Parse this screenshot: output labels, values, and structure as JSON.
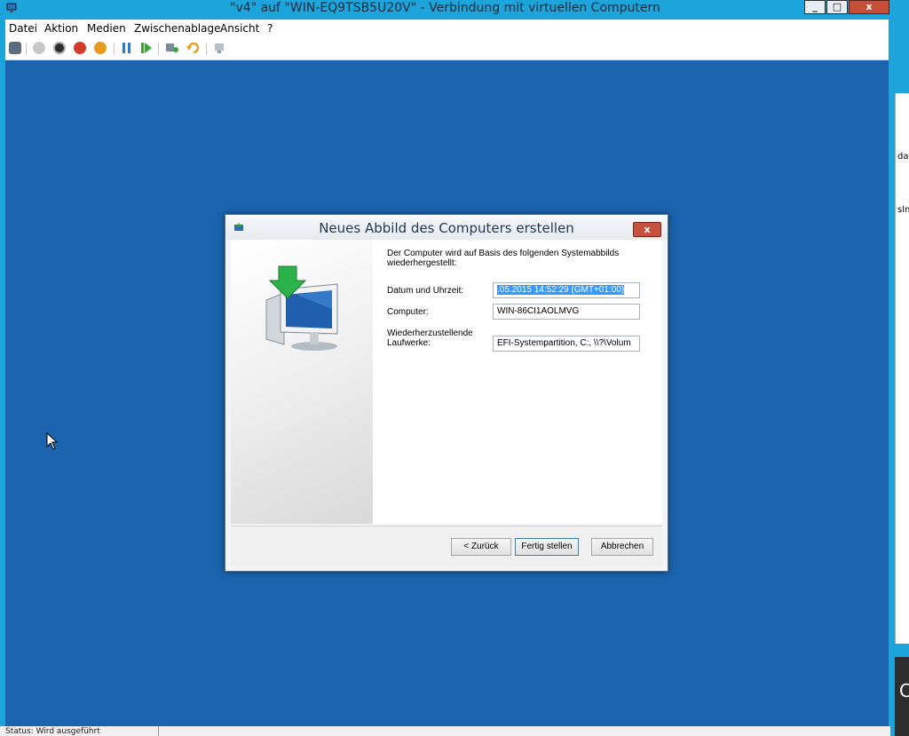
{
  "window": {
    "title": "\"v4\" auf \"WIN-EQ9TSB5U20V\" - Verbindung mit virtuellen Computern",
    "controls": {
      "minimize": "_",
      "maximize": "□",
      "close": "x"
    }
  },
  "menu": [
    "Datei",
    "Aktion",
    "Medien",
    "Zwischenablage",
    "Ansicht",
    "?"
  ],
  "toolbar": {
    "icons": [
      "ctrl-alt-del-icon",
      "start-icon",
      "turn-off-icon",
      "shutdown-icon",
      "save-icon",
      "pause-icon",
      "reset-icon",
      "checkpoint-icon",
      "revert-icon",
      "enhanced-session-icon"
    ]
  },
  "dialog": {
    "title": "Neues Abbild des Computers erstellen",
    "close": "x",
    "intro": "Der Computer wird auf Basis des folgenden Systemabbilds wiederhergestellt:",
    "date_label": "Datum und Uhrzeit:",
    "date_value": ".05.2015 14:52:29 (GMT+01:00)",
    "computer_label": "Computer:",
    "computer_value": "WIN-86CI1AOLMVG",
    "drives_label_line1": "Wiederherzustellende",
    "drives_label_line2": "Laufwerke:",
    "drives_value": "EFI-Systempartition, C:, \\\\?\\Volum",
    "back_button": "< Zurück",
    "finish_button": "Fertig stellen",
    "cancel_button": "Abbrechen"
  },
  "status": {
    "text": "Status: Wird ausgeführt"
  },
  "colors": {
    "guest_bg": "#1b63ad",
    "chrome": "#1da4da",
    "close_red": "#c74f3a"
  },
  "side_fragments": [
    "dat",
    "sln",
    "C"
  ]
}
